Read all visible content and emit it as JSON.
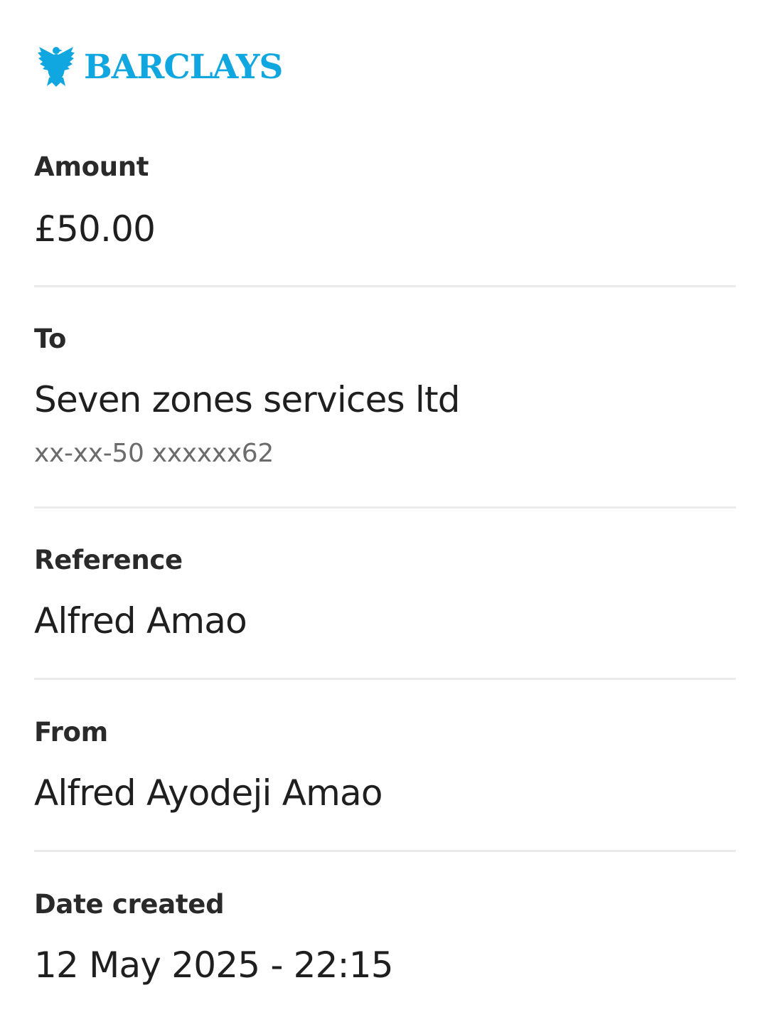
{
  "brand": {
    "name": "BARCLAYS",
    "color": "#10a6e0",
    "logo_icon": "eagle-icon"
  },
  "details": {
    "amount": {
      "label": "Amount",
      "value": "£50.00"
    },
    "to": {
      "label": "To",
      "value": "Seven zones services ltd",
      "account": "xx-xx-50 xxxxxx62"
    },
    "reference": {
      "label": "Reference",
      "value": "Alfred Amao"
    },
    "from": {
      "label": "From",
      "value": "Alfred Ayodeji Amao"
    },
    "date_created": {
      "label": "Date created",
      "value": "12 May 2025 - 22:15"
    }
  }
}
